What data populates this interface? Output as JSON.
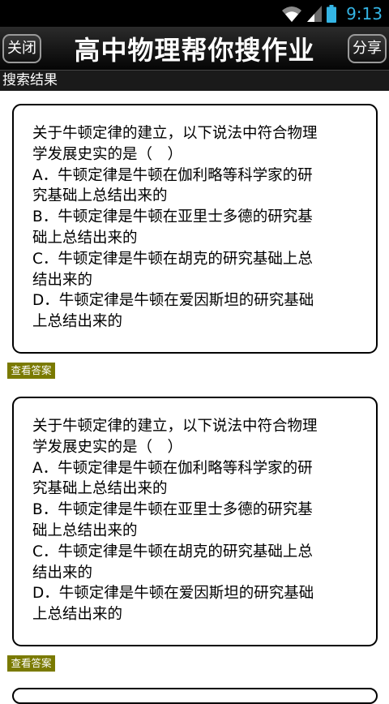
{
  "status_bar": {
    "time": "9:13"
  },
  "header": {
    "title": "高中物理帮你搜作业",
    "close_label": "关闭",
    "share_label": "分享"
  },
  "section": {
    "title": "搜索结果"
  },
  "results": [
    {
      "lines": [
        "关于牛顿定律的建立，以下说法中符合物理",
        "学发展史实的是（　）",
        "A．牛顿定律是牛顿在伽利略等科学家的研",
        "究基础上总结出来的",
        "B．牛顿定律是牛顿在亚里士多德的研究基",
        "础上总结出来的",
        "C．牛顿定律是牛顿在胡克的研究基础上总",
        "结出来的",
        "D．牛顿定律是牛顿在爱因斯坦的研究基础",
        "上总结出来的"
      ],
      "answer_label": "查看答案"
    },
    {
      "lines": [
        "关于牛顿定律的建立，以下说法中符合物理",
        "学发展史实的是（　）",
        "A．牛顿定律是牛顿在伽利略等科学家的研",
        "究基础上总结出来的",
        "B．牛顿定律是牛顿在亚里士多德的研究基",
        "础上总结出来的",
        "C．牛顿定律是牛顿在胡克的研究基础上总",
        "结出来的",
        "D．牛顿定律是牛顿在爱因斯坦的研究基础",
        "上总结出来的"
      ],
      "answer_label": "查看答案"
    }
  ]
}
